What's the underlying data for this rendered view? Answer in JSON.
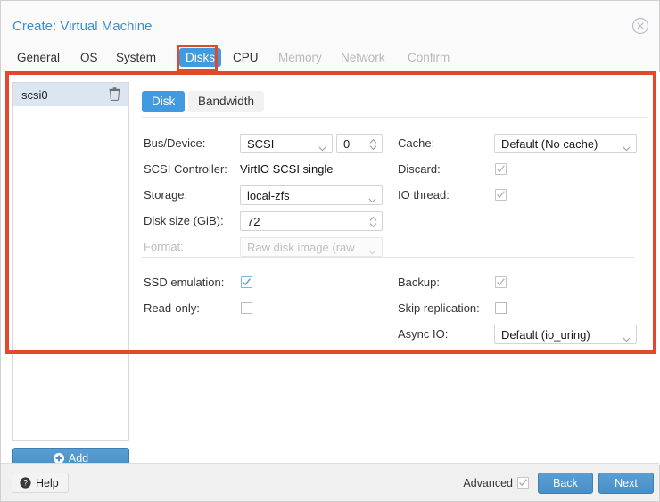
{
  "window": {
    "title": "Create: Virtual Machine",
    "close_icon": "close-circle-icon"
  },
  "tabs": [
    {
      "label": "General",
      "state": "enabled"
    },
    {
      "label": "OS",
      "state": "enabled"
    },
    {
      "label": "System",
      "state": "enabled"
    },
    {
      "label": "Disks",
      "state": "active"
    },
    {
      "label": "CPU",
      "state": "enabled"
    },
    {
      "label": "Memory",
      "state": "disabled"
    },
    {
      "label": "Network",
      "state": "disabled"
    },
    {
      "label": "Confirm",
      "state": "disabled"
    }
  ],
  "sidebar": {
    "items": [
      {
        "label": "scsi0",
        "delete_icon": "trash-icon",
        "selected": true
      }
    ],
    "add_button": {
      "label": "Add",
      "icon": "plus-circle-icon"
    }
  },
  "subtabs": [
    {
      "label": "Disk",
      "state": "active"
    },
    {
      "label": "Bandwidth",
      "state": "inactive"
    }
  ],
  "form": {
    "bus_device": {
      "label": "Bus/Device:",
      "value": "SCSI",
      "index_value": "0",
      "caret_icon": "chevron-down-icon",
      "spinner_icon": "spinner-updown-icon"
    },
    "scsi_controller": {
      "label": "SCSI Controller:",
      "value": "VirtIO SCSI single"
    },
    "storage": {
      "label": "Storage:",
      "value": "local-zfs",
      "caret_icon": "chevron-down-icon"
    },
    "disk_size": {
      "label": "Disk size (GiB):",
      "value": "72",
      "spinner_icon": "spinner-updown-icon"
    },
    "format": {
      "label": "Format:",
      "value": "Raw disk image (raw",
      "disabled": true,
      "caret_icon": "chevron-down-icon"
    },
    "cache": {
      "label": "Cache:",
      "value": "Default (No cache)",
      "caret_icon": "chevron-down-icon"
    },
    "discard": {
      "label": "Discard:",
      "checked": true,
      "disabled": true
    },
    "io_thread": {
      "label": "IO thread:",
      "checked": true,
      "disabled": true
    },
    "ssd_emulation": {
      "label": "SSD emulation:",
      "checked": true,
      "disabled": false
    },
    "read_only": {
      "label": "Read-only:",
      "checked": false,
      "disabled": false
    },
    "backup": {
      "label": "Backup:",
      "checked": true,
      "disabled": true
    },
    "skip_replication": {
      "label": "Skip replication:",
      "checked": false,
      "disabled": false
    },
    "async_io": {
      "label": "Async IO:",
      "value": "Default (io_uring)",
      "caret_icon": "chevron-down-icon"
    }
  },
  "footer": {
    "help": {
      "label": "Help",
      "icon": "question-circle-icon"
    },
    "advanced": {
      "label": "Advanced",
      "checked": true
    },
    "back": "Back",
    "next": "Next"
  },
  "colors": {
    "accent_blue": "#3f9ae0",
    "button_blue": "#4a8fc4",
    "title_blue": "#3f8cc9",
    "highlight_red": "#e2492c",
    "row_selected": "#dbe6f2"
  }
}
